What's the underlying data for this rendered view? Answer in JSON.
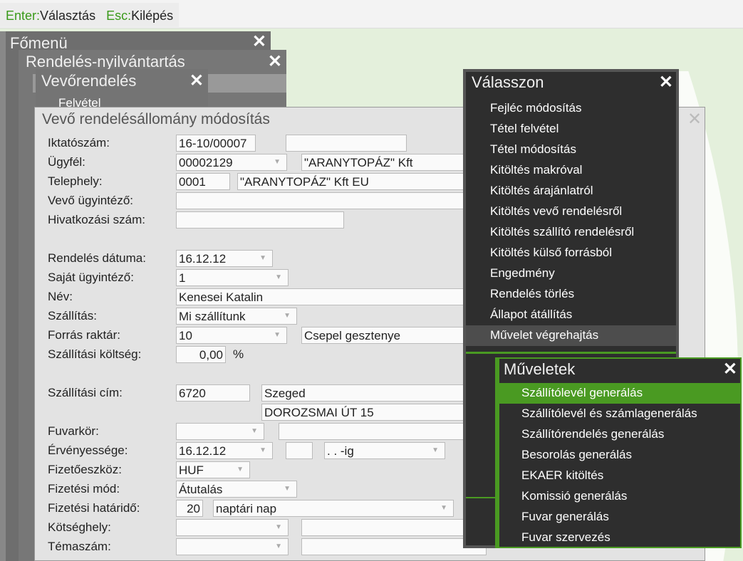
{
  "hints": {
    "enter_key": "Enter:",
    "enter_label": "Választás",
    "esc_key": "Esc:",
    "esc_label": "Kilépés"
  },
  "windows": {
    "main": "Főmenü",
    "orders": "Rendelés-nyilvántartás",
    "customer_order": "Vevőrendelés",
    "customer_order_item": "Felvétel"
  },
  "form": {
    "title": "Vevő rendelésállomány módosítás",
    "rows": [
      {
        "label": "Iktatószám:",
        "v1": "16-10/00007",
        "v2": ""
      },
      {
        "label": "Ügyfél:",
        "v1": "00002129",
        "v2": "\"ARANYTOPÁZ\" Kft"
      },
      {
        "label": "Telephely:",
        "v1": "0001",
        "v2": "\"ARANYTOPÁZ\" Kft EU"
      },
      {
        "label": "Vevő ügyintéző:",
        "v1": ""
      },
      {
        "label": "Hivatkozási szám:",
        "v1": ""
      },
      {
        "label": "Rendelés dátuma:",
        "v1": "16.12.12"
      },
      {
        "label": "Saját ügyintéző:",
        "v1": "1"
      },
      {
        "label": "Név:",
        "v1": "Kenesei Katalin"
      },
      {
        "label": "Szállítás:",
        "v1": "Mi szállítunk"
      },
      {
        "label": "Forrás raktár:",
        "v1": "10",
        "v2": "Csepel gesztenye"
      },
      {
        "label": "Szállítási költség:",
        "v1": "0,00",
        "unit": "%"
      },
      {
        "label": "Szállítási cím:",
        "v1": "6720",
        "v2": "Szeged",
        "v3": "DOROZSMAI ÚT 15"
      },
      {
        "label": "Fuvarkör:",
        "v1": ""
      },
      {
        "label": "Érvényessége:",
        "v1": "16.12.12",
        "v3": " .  .  -ig"
      },
      {
        "label": "Fizetőeszköz:",
        "v1": "HUF"
      },
      {
        "label": "Fizetési mód:",
        "v1": "Átutalás"
      },
      {
        "label": "Fizetési határidő:",
        "v1": "20",
        "v2": "naptári nap"
      },
      {
        "label": "Kötséghely:",
        "v1": ""
      },
      {
        "label": "Témaszám:",
        "v1": ""
      }
    ]
  },
  "choose_menu": {
    "title": "Válasszon",
    "items": [
      "Fejléc módosítás",
      "Tétel felvétel",
      "Tétel módosítás",
      "Kitöltés makróval",
      "Kitöltés árajánlatról",
      "Kitöltés vevő rendelésről",
      "Kitöltés szállító rendelésről",
      "Kitöltés külső forrásból",
      "Engedmény",
      "Rendelés törlés",
      "Állapot átállítás",
      "Művelet végrehajtás"
    ],
    "selected": 11
  },
  "operations_menu": {
    "title": "Műveletek",
    "items": [
      "Szállítólevél generálás",
      "Szállítólevél és számlagenerálás",
      "Szállítórendelés generálás",
      "Besorolás generálás",
      "EKAER kitöltés",
      "Komissió generálás",
      "Fuvar generálás",
      "Fuvar szervezés"
    ],
    "selected": 0
  },
  "close": "✕"
}
